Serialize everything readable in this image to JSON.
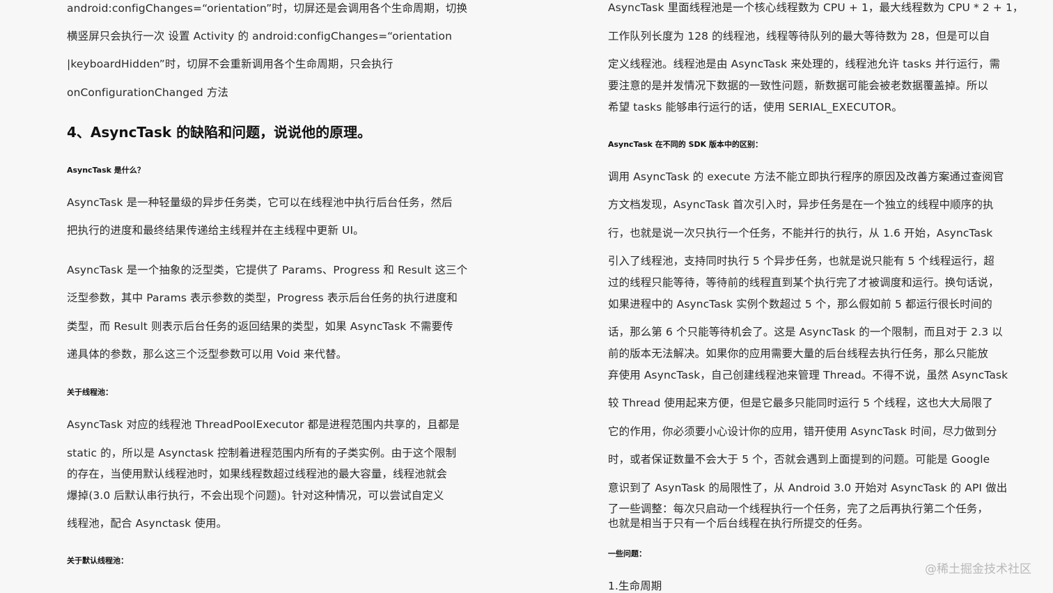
{
  "left": {
    "p0": [
      "android:configChanges=“orientation”时，切屏还是会调用各个生命周期，切换",
      "横竖屏只会执行一次  设置 Activity 的 android:configChanges=“orientation",
      "|keyboardHidden”时，切屏不会重新调用各个生命周期，只会执行",
      "onConfigurationChanged 方法"
    ],
    "heading": "4、AsyncTask 的缺陷和问题，说说他的原理。",
    "sub_what": "AsyncTask 是什么？",
    "p1": [
      "AsyncTask 是一种轻量级的异步任务类，它可以在线程池中执行后台任务，然后",
      "把执行的进度和最终结果传递给主线程并在主线程中更新 UI。"
    ],
    "p2": [
      "AsyncTask 是一个抽象的泛型类，它提供了 Params、Progress 和 Result 这三个",
      "泛型参数，其中 Params 表示参数的类型，Progress 表示后台任务的执行进度和",
      "类型，而 Result 则表示后台任务的返回结果的类型，如果 AsyncTask 不需要传",
      "递具体的参数，那么这三个泛型参数可以用 Void 来代替。"
    ],
    "sub_pool": "关于线程池：",
    "p3": [
      "AsyncTask 对应的线程池 ThreadPoolExecutor 都是进程范围内共享的，且都是",
      "static 的，所以是 Asynctask 控制着进程范围内所有的子类实例。由于这个限制",
      "的存在，当使用默认线程池时，如果线程数超过线程池的最大容量，线程池就会",
      "爆掉(3.0 后默认串行执行，不会出现个问题)。针对这种情况，可以尝试自定义",
      "线程池，配合 Asynctask 使用。"
    ],
    "sub_default": "关于默认线程池："
  },
  "right": {
    "p0": [
      "AsyncTask 里面线程池是一个核心线程数为 CPU + 1，最大线程数为 CPU * 2 + 1，",
      "工作队列长度为 128 的线程池，线程等待队列的最大等待数为 28，但是可以自",
      "定义线程池。线程池是由 AsyncTask 来处理的，线程池允许 tasks 并行运行，需",
      "要注意的是并发情况下数据的一致性问题，新数据可能会被老数据覆盖掉。所以",
      "希望 tasks 能够串行运行的话，使用 SERIAL_EXECUTOR。"
    ],
    "sub_sdk": "AsyncTask 在不同的 SDK 版本中的区别：",
    "p1": [
      "调用 AsyncTask 的 execute 方法不能立即执行程序的原因及改善方案通过查阅官",
      "方文档发现，AsyncTask 首次引入时，异步任务是在一个独立的线程中顺序的执",
      "行，也就是说一次只执行一个任务，不能并行的执行，从 1.6 开始，AsyncTask",
      "引入了线程池，支持同时执行 5 个异步任务，也就是说只能有 5 个线程运行，超",
      "过的线程只能等待，等待前的线程直到某个执行完了才被调度和运行。换句话说，",
      "如果进程中的 AsyncTask 实例个数超过 5 个，那么假如前 5 都运行很长时间的",
      "话，那么第 6 个只能等待机会了。这是 AsyncTask 的一个限制，而且对于 2.3 以",
      "前的版本无法解决。如果你的应用需要大量的后台线程去执行任务，那么只能放",
      "弃使用 AsyncTask，自己创建线程池来管理 Thread。不得不说，虽然 AsyncTask",
      "较 Thread 使用起来方便，但是它最多只能同时运行 5 个线程，这也大大局限了",
      "它的作用，你必须要小心设计你的应用，错开使用 AsyncTask 时间，尽力做到分",
      "时，或者保证数量不会大于 5 个，否就会遇到上面提到的问题。可能是 Google",
      "意识到了 AsynTask 的局限性了，从 Android 3.0 开始对 AsyncTask 的 API 做出",
      "了一些调整：每次只启动一个线程执行一个任务，完了之后再执行第二个任务，",
      "也就是相当于只有一个后台线程在执行所提交的任务。"
    ],
    "sub_issues": "一些问题：",
    "item1": "1.生命周期"
  },
  "watermark": "@稀土掘金技术社区"
}
